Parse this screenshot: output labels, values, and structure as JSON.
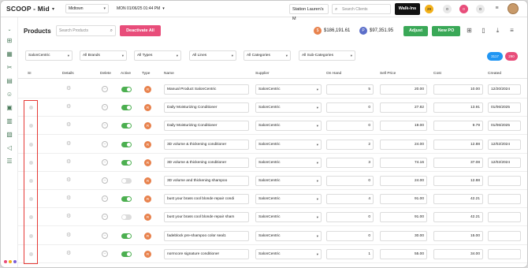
{
  "topbar": {
    "brand": "SCOOP - Mid",
    "location": "Midtown",
    "datetime": "MON 01/06/25  01:44 PM",
    "station": "Station Lauren's M",
    "search_placeholder": "Search Clients",
    "walkins": "Walk-Ins",
    "badges": [
      {
        "label": "29",
        "color": "#f2b019"
      },
      {
        "label": "0",
        "color": "#e9e9e9"
      },
      {
        "label": "0",
        "color": "#e84d7a"
      },
      {
        "label": "0",
        "color": "#e9e9e9"
      }
    ]
  },
  "header": {
    "title": "Products",
    "search_placeholder": "Search Products",
    "deactivate_label": "Deactivate All",
    "cost_total": "$186,191.61",
    "price_total": "$97,351.95",
    "cost_icon": "$",
    "price_icon": "P",
    "adjust_label": "Adjust",
    "newpo_label": "New PO"
  },
  "filters": [
    "SalonCentric",
    "All Brands",
    "All Types",
    "All Lines",
    "All Categories",
    "All Sub-Categories"
  ],
  "pills": [
    {
      "label": "3117",
      "color": "#2196f3"
    },
    {
      "label": "290",
      "color": "#e84d7a"
    }
  ],
  "columns": [
    "SI",
    "Details",
    "Delete",
    "Active",
    "Type",
    "Name",
    "Supplier",
    "On Hand",
    "Sell Price",
    "Cost",
    "Created"
  ],
  "rows": [
    {
      "active": true,
      "type": "R",
      "name": "Manual Product SalonCentric",
      "supplier": "SalonCentric",
      "on_hand": "5",
      "sell": "20.00",
      "cost": "10.00",
      "created": "12/20/2024"
    },
    {
      "active": true,
      "type": "R",
      "name": "Daily Moisturizing Conditioner",
      "supplier": "SalonCentric",
      "on_hand": "0",
      "sell": "27.82",
      "cost": "13.91",
      "created": "01/06/2025"
    },
    {
      "active": true,
      "type": "R",
      "name": "Daily Moisturizing Conditioner",
      "supplier": "SalonCentric",
      "on_hand": "0",
      "sell": "19.00",
      "cost": "9.79",
      "created": "01/06/2025"
    },
    {
      "active": true,
      "type": "R",
      "name": "3D volume & thickening conditioner",
      "supplier": "SalonCentric",
      "on_hand": "2",
      "sell": "24.00",
      "cost": "12.88",
      "created": "12/02/2024"
    },
    {
      "active": true,
      "type": "R",
      "name": "3D volume & thickening conditioner",
      "supplier": "SalonCentric",
      "on_hand": "3",
      "sell": "74.16",
      "cost": "37.08",
      "created": "12/02/2024"
    },
    {
      "active": false,
      "type": "R",
      "name": "3D volume and thickening shampoo",
      "supplier": "SalonCentric",
      "on_hand": "0",
      "sell": "24.00",
      "cost": "12.88",
      "created": ""
    },
    {
      "active": true,
      "type": "R",
      "name": "bust your brass cool blonde repair condi",
      "supplier": "SalonCentric",
      "on_hand": "4",
      "sell": "91.00",
      "cost": "42.21",
      "created": ""
    },
    {
      "active": false,
      "type": "R",
      "name": "bust your brass cool blonde repair sham",
      "supplier": "SalonCentric",
      "on_hand": "0",
      "sell": "91.00",
      "cost": "42.21",
      "created": ""
    },
    {
      "active": true,
      "type": "R",
      "name": "fadeblock pre-shampoo color seal1",
      "supplier": "SalonCentric",
      "on_hand": "0",
      "sell": "30.00",
      "cost": "15.00",
      "created": ""
    },
    {
      "active": true,
      "type": "R",
      "name": "normcore signature conditioner",
      "supplier": "SalonCentric",
      "on_hand": "1",
      "sell": "55.00",
      "cost": "34.00",
      "created": ""
    }
  ],
  "colors": {
    "green": "#3aa857",
    "pink": "#e84d7a",
    "orange": "#e8824d",
    "toggle_on": "#4caf50",
    "toggle_off": "#dcdcdc",
    "highlight": "#e53935"
  }
}
